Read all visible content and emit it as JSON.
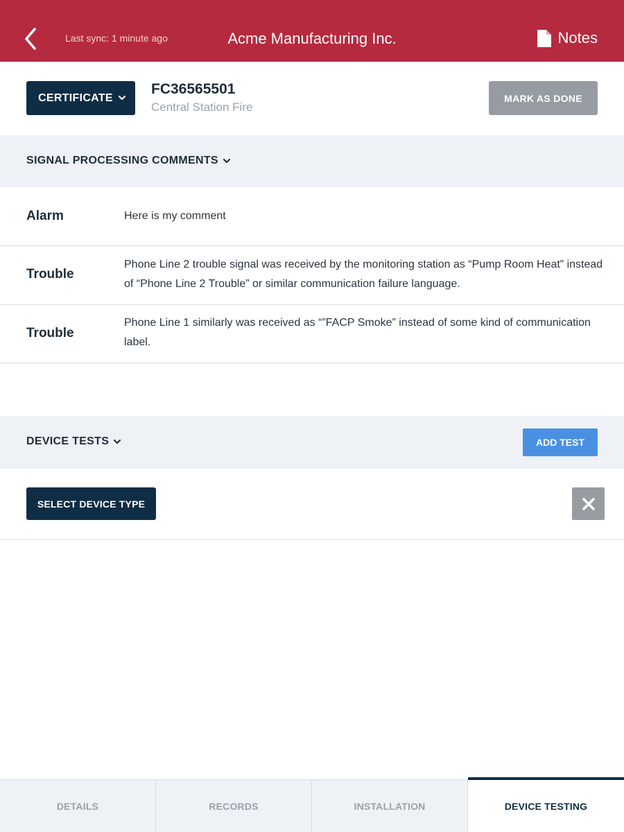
{
  "topbar": {
    "sync_text": "Last sync: 1 minute ago",
    "title": "Acme Manufacturing Inc.",
    "notes_label": "Notes"
  },
  "header": {
    "certificate_label": "CERTIFICATE",
    "record_id": "FC36565501",
    "record_type": "Central Station Fire",
    "mark_done_label": "MARK AS DONE"
  },
  "signal_section": {
    "title": "SIGNAL PROCESSING COMMENTS",
    "comments": [
      {
        "type": "Alarm",
        "text": "Here is my comment"
      },
      {
        "type": "Trouble",
        "text": "Phone Line 2 trouble signal was received by the monitoring station as “Pump Room Heat” instead of “Phone Line 2 Trouble” or similar communication failure language."
      },
      {
        "type": "Trouble",
        "text": "Phone Line 1 similarly was received as “”FACP Smoke” instead of some kind of communication label."
      }
    ]
  },
  "device_section": {
    "title": "DEVICE TESTS",
    "add_test_label": "ADD TEST",
    "select_device_label": "SELECT DEVICE TYPE"
  },
  "tabs": [
    {
      "label": "DETAILS",
      "active": false
    },
    {
      "label": "RECORDS",
      "active": false
    },
    {
      "label": "INSTALLATION",
      "active": false
    },
    {
      "label": "DEVICE TESTING",
      "active": true
    }
  ],
  "colors": {
    "topbar": "#b52a3e",
    "navy": "#0f2d44",
    "gray_button": "#979ca3",
    "blue_button": "#4a90e2",
    "section_bg": "#eef1f6"
  },
  "icons": {
    "back": "chevron-left-icon",
    "notes": "document-icon",
    "dropdown": "chevron-down-icon",
    "close": "close-icon"
  }
}
